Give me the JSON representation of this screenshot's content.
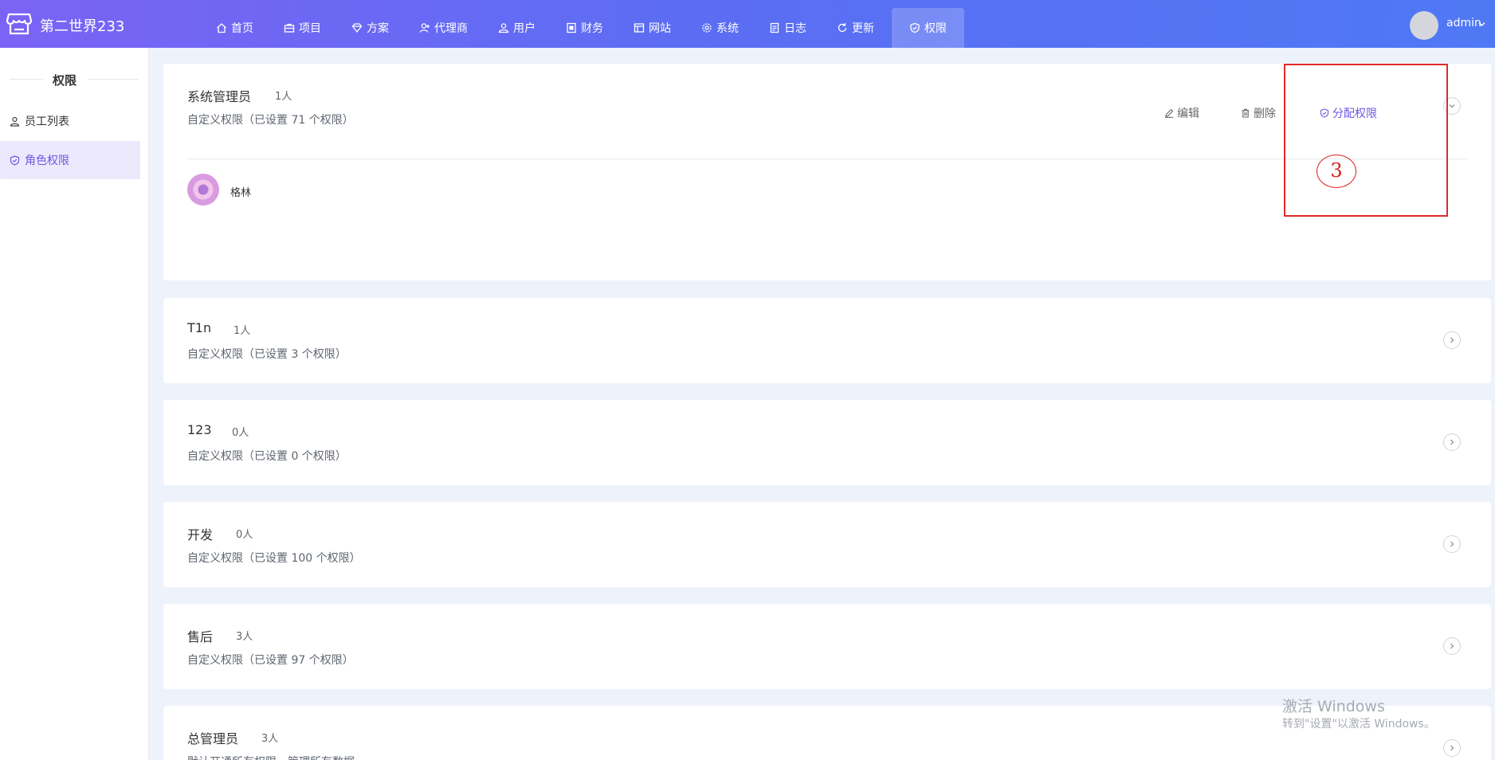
{
  "app": {
    "brand": "第二世界233",
    "user": "admin"
  },
  "nav": [
    {
      "label": "首页",
      "icon": "home-icon"
    },
    {
      "label": "项目",
      "icon": "briefcase-icon"
    },
    {
      "label": "方案",
      "icon": "diamond-icon"
    },
    {
      "label": "代理商",
      "icon": "user-plus-icon"
    },
    {
      "label": "用户",
      "icon": "users-icon"
    },
    {
      "label": "财务",
      "icon": "finance-icon"
    },
    {
      "label": "网站",
      "icon": "window-icon"
    },
    {
      "label": "系统",
      "icon": "gear-icon"
    },
    {
      "label": "日志",
      "icon": "document-icon"
    },
    {
      "label": "更新",
      "icon": "refresh-icon"
    },
    {
      "label": "权限",
      "icon": "shield-icon",
      "active": true
    }
  ],
  "sidebar": {
    "title": "权限",
    "items": [
      {
        "label": "员工列表",
        "icon": "user-icon"
      },
      {
        "label": "角色权限",
        "icon": "shield-icon",
        "active": true
      }
    ]
  },
  "actions": {
    "edit": "编辑",
    "delete": "删除",
    "assign": "分配权限"
  },
  "roles": [
    {
      "name": "系统管理员",
      "count": "1人",
      "desc": "自定义权限（已设置 71 个权限）",
      "expanded": true,
      "members": [
        {
          "name": "格林"
        }
      ]
    },
    {
      "name": "T1n",
      "count": "1人",
      "desc": "自定义权限（已设置 3 个权限）"
    },
    {
      "name": "123",
      "count": "0人",
      "desc": "自定义权限（已设置 0 个权限）"
    },
    {
      "name": "开发",
      "count": "0人",
      "desc": "自定义权限（已设置 100 个权限）"
    },
    {
      "name": "售后",
      "count": "3人",
      "desc": "自定义权限（已设置 97 个权限）"
    },
    {
      "name": "总管理员",
      "count": "3人",
      "desc": "默认开通所有权限，管理所有数据"
    }
  ],
  "annotation": {
    "marker": "3"
  },
  "watermark": {
    "line1": "激活 Windows",
    "line2": "转到\"设置\"以激活 Windows。"
  },
  "colors": {
    "accent": "#6a58e8",
    "topbar_start": "#7b63f5",
    "topbar_end": "#4f78f5",
    "annotation_red": "#e12a2a"
  }
}
